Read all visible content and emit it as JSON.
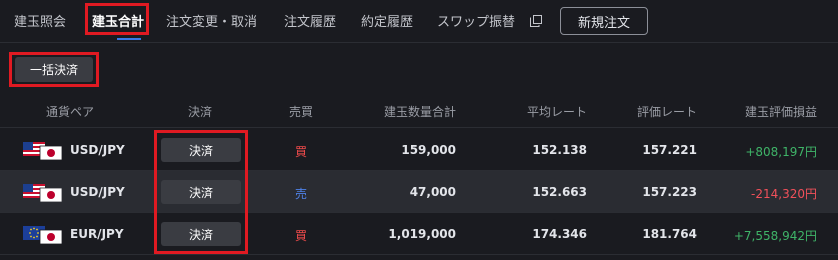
{
  "tabs": [
    {
      "label": "建玉照会"
    },
    {
      "label": "建玉合計"
    },
    {
      "label": "注文変更・取消"
    },
    {
      "label": "注文履歴"
    },
    {
      "label": "約定履歴"
    },
    {
      "label": "スワップ振替"
    }
  ],
  "toolbar": {
    "new_order_label": "新規注文",
    "bulk_settle_label": "一括決済"
  },
  "table": {
    "headers": [
      "通貨ペア",
      "決済",
      "売買",
      "建玉数量合計",
      "平均レート",
      "評価レート",
      "建玉評価損益"
    ],
    "rows": [
      {
        "pair": "USD/JPY",
        "flag_base": "us-flag",
        "flag_quote": "jp-flag",
        "settle_label": "決済",
        "side": "買",
        "qty": "159,000",
        "avg_rate": "152.138",
        "eval_rate": "157.221",
        "pnl": "+808,197円"
      },
      {
        "pair": "USD/JPY",
        "flag_base": "us-flag",
        "flag_quote": "jp-flag",
        "settle_label": "決済",
        "side": "売",
        "qty": "47,000",
        "avg_rate": "152.663",
        "eval_rate": "157.223",
        "pnl": "-214,320円"
      },
      {
        "pair": "EUR/JPY",
        "flag_base": "eu-flag",
        "flag_quote": "jp-flag",
        "settle_label": "決済",
        "side": "買",
        "qty": "1,019,000",
        "avg_rate": "174.346",
        "eval_rate": "181.764",
        "pnl": "+7,558,942円"
      }
    ]
  },
  "colors": {
    "buy": "#ef4b4b",
    "sell": "#4f82e8",
    "profit": "#3fb468",
    "loss": "#f0505a",
    "highlight": "#e01a22",
    "active_underline": "#3b78e7"
  }
}
